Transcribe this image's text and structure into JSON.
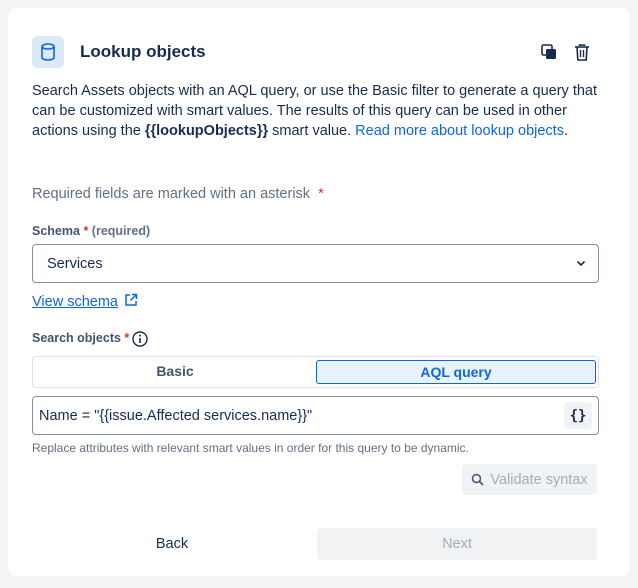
{
  "header": {
    "title": "Lookup objects",
    "icon": "database-cylinder-icon",
    "copy_icon": "copy-icon",
    "delete_icon": "trash-icon"
  },
  "description": {
    "text_1": "Search Assets objects with an AQL query, or use the Basic filter to generate a query that can be customized with smart values. The results of this query can be used in other actions using the ",
    "smart_value": "{{lookupObjects}}",
    "text_2": " smart value. ",
    "link": "Read more about lookup objects",
    "text_3": "."
  },
  "required_note": {
    "text": "Required fields are marked with an asterisk",
    "asterisk": "*"
  },
  "schema": {
    "label": "Schema",
    "asterisk": "*",
    "required_text": "(required)",
    "value": "Services",
    "view_link": "View schema"
  },
  "search_objects": {
    "label": "Search objects",
    "asterisk": "*",
    "tabs": [
      "Basic",
      "AQL query"
    ],
    "active_tab": "AQL query",
    "query": "Name = \"{{issue.Affected services.name}}\"",
    "braces_label": "{}",
    "helper": "Replace attributes with relevant smart values in order for this query to be dynamic.",
    "validate_label": "Validate syntax"
  },
  "footer": {
    "back_label": "Back",
    "next_label": "Next"
  },
  "colors": {
    "accent": "#0c66e4",
    "required": "#c9372c",
    "text": "#172b4d",
    "subtle": "#626f86"
  }
}
